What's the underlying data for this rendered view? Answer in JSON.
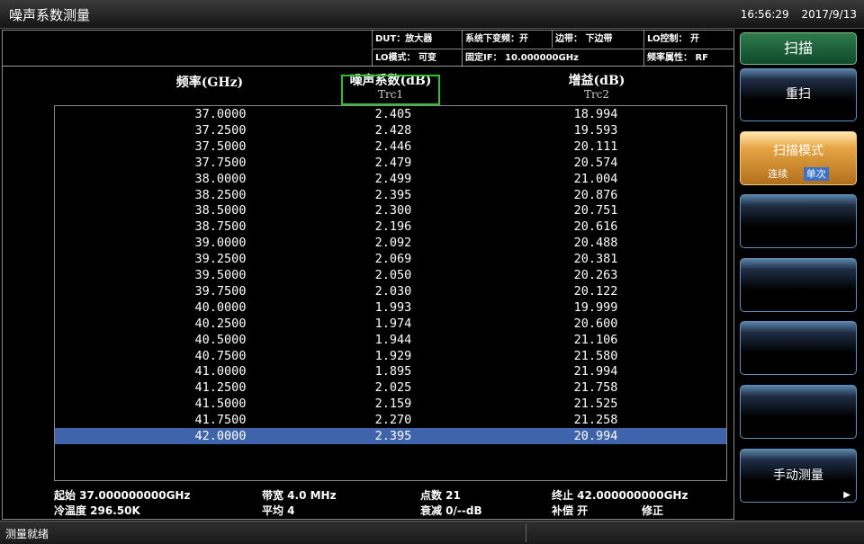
{
  "window": {
    "title": "噪声系数测量",
    "time": "16:56:29",
    "date": "2017/9/13"
  },
  "info": {
    "dut": "DUT：放大器",
    "downconvert": "系统下变频：开",
    "sideband": "边带： 下边带",
    "lo_control": "LO控制： 开",
    "lo_mode": "LO模式： 可变",
    "fixed_if": "固定IF： 10.000000GHz",
    "freq_attr": "频率属性： RF"
  },
  "table": {
    "headers": [
      {
        "label": "频率(GHz)",
        "sub": ""
      },
      {
        "label": "噪声系数(dB)",
        "sub": "Trc1"
      },
      {
        "label": "增益(dB)",
        "sub": "Trc2"
      }
    ],
    "rows": [
      [
        "37.0000",
        "2.405",
        "18.994"
      ],
      [
        "37.2500",
        "2.428",
        "19.593"
      ],
      [
        "37.5000",
        "2.446",
        "20.111"
      ],
      [
        "37.7500",
        "2.479",
        "20.574"
      ],
      [
        "38.0000",
        "2.499",
        "21.004"
      ],
      [
        "38.2500",
        "2.395",
        "20.876"
      ],
      [
        "38.5000",
        "2.300",
        "20.751"
      ],
      [
        "38.7500",
        "2.196",
        "20.616"
      ],
      [
        "39.0000",
        "2.092",
        "20.488"
      ],
      [
        "39.2500",
        "2.069",
        "20.381"
      ],
      [
        "39.5000",
        "2.050",
        "20.263"
      ],
      [
        "39.7500",
        "2.030",
        "20.122"
      ],
      [
        "40.0000",
        "1.993",
        "19.999"
      ],
      [
        "40.2500",
        "1.974",
        "20.600"
      ],
      [
        "40.5000",
        "1.944",
        "21.106"
      ],
      [
        "40.7500",
        "1.929",
        "21.580"
      ],
      [
        "41.0000",
        "1.895",
        "21.994"
      ],
      [
        "41.2500",
        "2.025",
        "21.758"
      ],
      [
        "41.5000",
        "2.159",
        "21.525"
      ],
      [
        "41.7500",
        "2.270",
        "21.258"
      ],
      [
        "42.0000",
        "2.395",
        "20.994"
      ]
    ],
    "selected_row": 20
  },
  "footer": {
    "start": "起始  37.000000000GHz",
    "bandwidth": "带宽  4.0  MHz",
    "points": "点数  21",
    "stop": "终止  42.000000000GHz",
    "cold_temp": "冷温度 296.50K",
    "average": "平均  4",
    "attenuation": "衰减  0/--dB",
    "compensation": "补偿  开",
    "correction": "修正"
  },
  "softkeys": {
    "scan": "扫描",
    "rescan": "重扫",
    "scan_mode": "扫描模式",
    "scan_mode_continuous": "连续",
    "scan_mode_single": "单次",
    "manual_measure": "手动测量"
  },
  "status": {
    "message": "测量就绪"
  }
}
